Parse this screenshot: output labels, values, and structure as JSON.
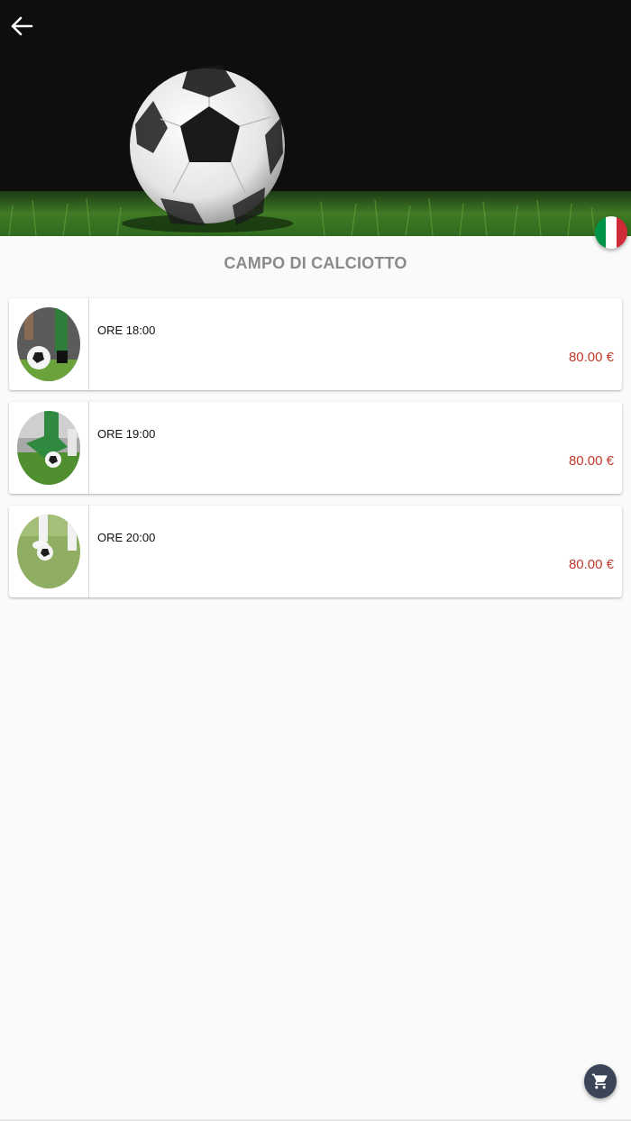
{
  "header": {
    "back_icon": "arrow-left-icon",
    "language_icon": "italy-flag-icon",
    "flag_colors": [
      "#009246",
      "#ffffff",
      "#ce2b37"
    ]
  },
  "page": {
    "title": "CAMPO DI CALCIOTTO"
  },
  "slots": [
    {
      "time": "ORE 18:00",
      "price": "80.00 €",
      "image": "player-kicking-ball-photo"
    },
    {
      "time": "ORE 19:00",
      "price": "80.00 €",
      "image": "players-tackling-ball-photo"
    },
    {
      "time": "ORE 20:00",
      "price": "80.00 €",
      "image": "player-foot-on-ball-photo"
    }
  ],
  "cart": {
    "icon": "shopping-cart-icon"
  },
  "colors": {
    "price": "#c0392b",
    "fab": "#3a4558",
    "title": "#8a8a8a"
  }
}
